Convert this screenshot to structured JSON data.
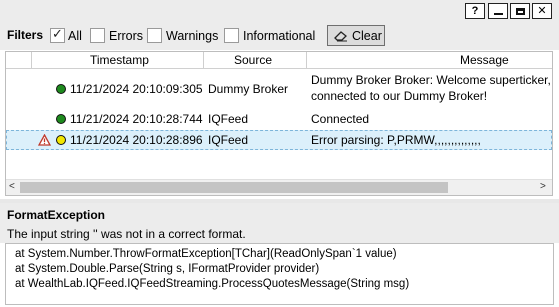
{
  "titlebar": {
    "buttons": [
      {
        "name": "help-button",
        "glyph": "?"
      },
      {
        "name": "minimize-button",
        "glyph": "▬"
      },
      {
        "name": "maximize-button",
        "glyph": "▣"
      },
      {
        "name": "close-button",
        "glyph": "✕"
      }
    ]
  },
  "filters": {
    "title": "Filters",
    "all": {
      "label": "All",
      "checked": true
    },
    "errors": {
      "label": "Errors",
      "checked": false
    },
    "warnings": {
      "label": "Warnings",
      "checked": false
    },
    "informational": {
      "label": "Informational",
      "checked": false
    },
    "clear_label": "Clear",
    "clear_icon": "eraser-icon"
  },
  "grid": {
    "columns": [
      "Timestamp",
      "Source",
      "Message"
    ],
    "rows": [
      {
        "status": "ok",
        "dot_color": "#1e8a1e",
        "warn": false,
        "timestamp": "11/21/2024 20:10:09:305",
        "source": "Dummy Broker",
        "message_line1": "Dummy Broker Broker: Welcome superticker,",
        "message_line2": "connected to our Dummy Broker!"
      },
      {
        "status": "ok",
        "dot_color": "#1e8a1e",
        "warn": false,
        "timestamp": "11/21/2024 20:10:28:744",
        "source": "IQFeed",
        "message_line1": "Connected",
        "message_line2": ""
      },
      {
        "status": "error",
        "dot_color": "#f2e600",
        "warn": true,
        "timestamp": "11/21/2024 20:10:28:896",
        "source": "IQFeed",
        "message_line1": "Error parsing: P,PRMW,,,,,,,,,,,,,,",
        "message_line2": ""
      }
    ]
  },
  "exception": {
    "title": "FormatException",
    "message": "The input string '' was not in a correct format.",
    "trace": [
      "at System.Number.ThrowFormatException[TChar](ReadOnlySpan`1 value)",
      "at System.Double.Parse(String s, IFormatProvider provider)",
      "at WealthLab.IQFeed.IQFeedStreaming.ProcessQuotesMessage(String msg)"
    ]
  }
}
